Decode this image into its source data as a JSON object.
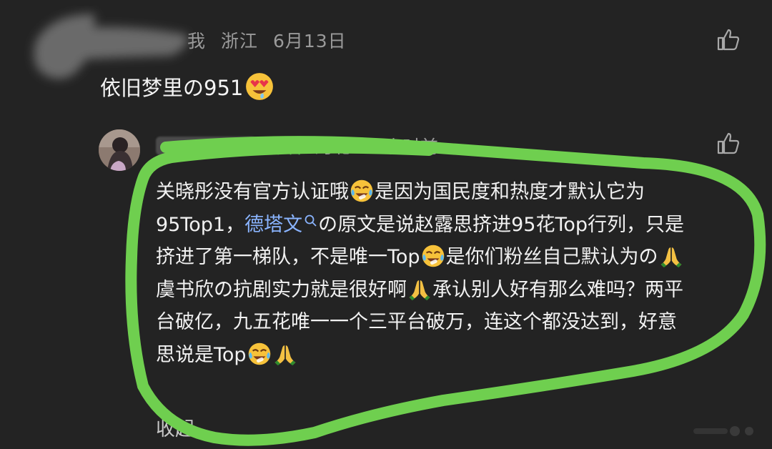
{
  "comment": {
    "meta_tag": "我",
    "location": "浙江",
    "date": "6月13日",
    "text": "依旧梦里の951",
    "emoji": "heart-eyes-emoji"
  },
  "reply": {
    "author_badge": "作者",
    "location": "河北",
    "time": "19小时前",
    "lines": [
      {
        "parts": [
          "关晓彤没有官方认证哦",
          "是因为国民度和热度才默认它为"
        ]
      },
      {
        "prefix": "95Top1，",
        "link": "德塔文",
        "suffix": "の原文是说赵露思挤进95花Top行列，只是"
      },
      {
        "parts": [
          "挤进了第一梯队，不是唯一Top",
          "是你们粉丝自己默认为の"
        ]
      },
      {
        "parts": [
          "虞书欣の抗剧实力就是很好啊",
          "承认别人好有那么难吗？两平"
        ]
      },
      {
        "text": "台破亿，九五花唯一一个三平台破万，连这个都没达到，好意"
      },
      {
        "text": "思说是Top"
      }
    ],
    "collapse_label": "收起"
  },
  "colors": {
    "background": "#232323",
    "highlight_outline": "#6fcf4f",
    "link": "#8ab4ff",
    "author_badge": "#4caf50"
  },
  "icons": [
    "thumbs-up-icon",
    "search-icon",
    "crying-laughing-emoji",
    "pray-emoji",
    "heart-eyes-emoji"
  ]
}
